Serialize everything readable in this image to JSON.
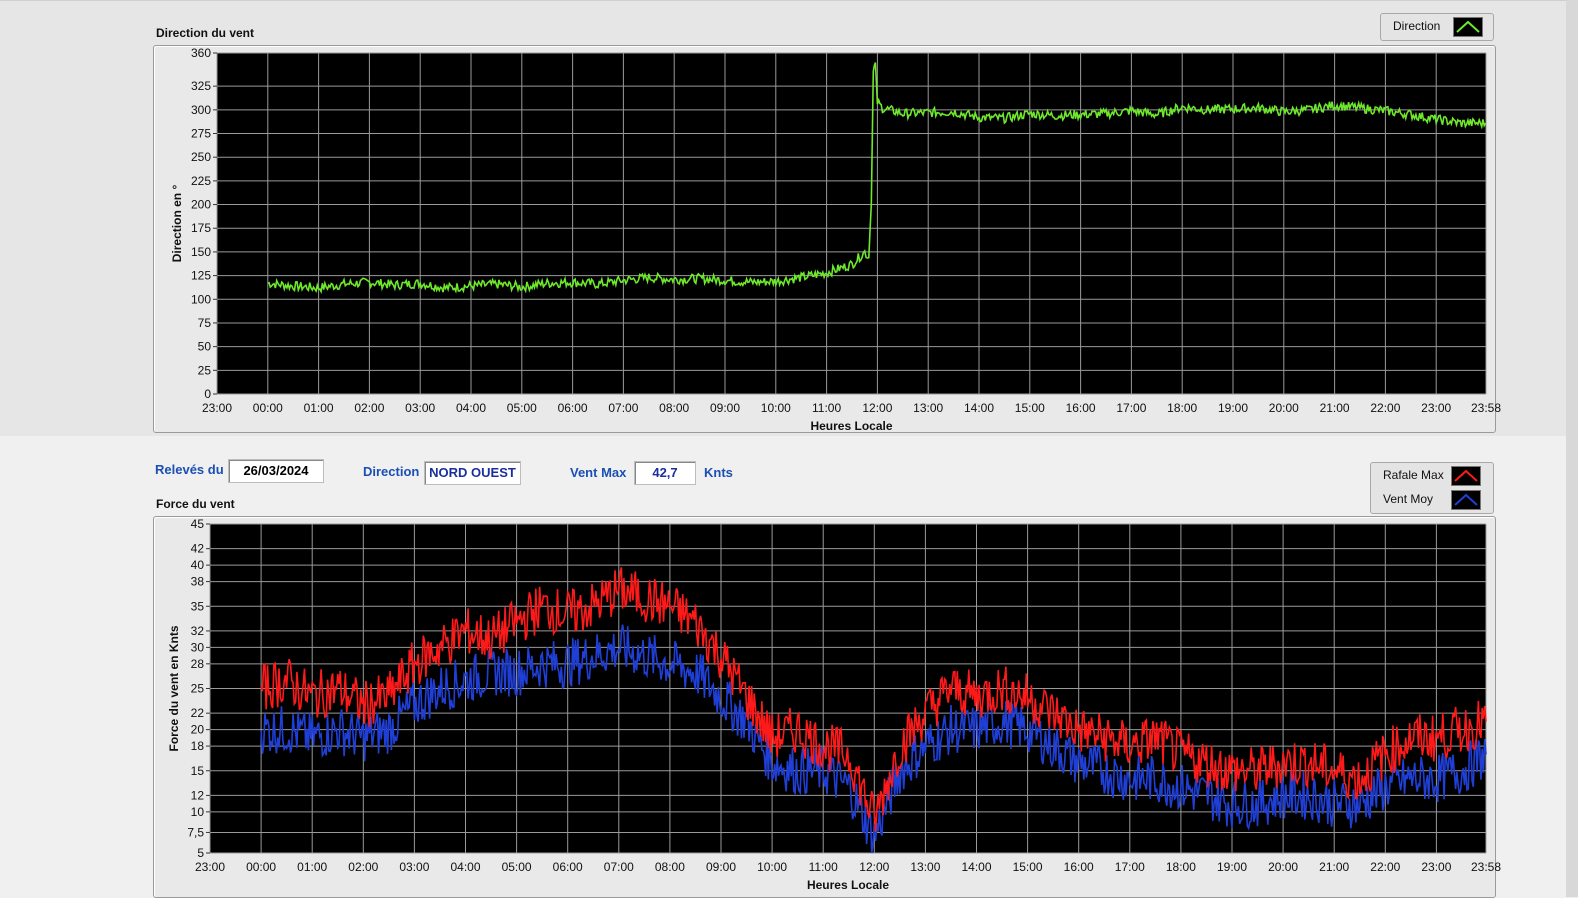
{
  "direction_panel": {
    "title": "Direction du vent",
    "legend": [
      {
        "label": "Direction",
        "color": "#6de82b"
      }
    ]
  },
  "info": {
    "date_label": "Relevés du",
    "date_value": "26/03/2024",
    "direction_label": "Direction",
    "direction_value": "NORD OUEST",
    "ventmax_label": "Vent Max",
    "ventmax_value": "42,7",
    "ventmax_unit": "Knts"
  },
  "force_panel": {
    "title": "Force du vent",
    "legend": [
      {
        "label": "Rafale Max",
        "color": "#ff1a1a"
      },
      {
        "label": "Vent Moy",
        "color": "#1f3fd6"
      }
    ]
  },
  "chart_data": [
    {
      "type": "line",
      "xlabel": "Heures Locale",
      "ylabel": "Direction en °",
      "ylim": [
        0,
        360
      ],
      "y_ticks": [
        "0",
        "25",
        "50",
        "75",
        "100",
        "125",
        "150",
        "175",
        "200",
        "225",
        "250",
        "275",
        "300",
        "325",
        "360"
      ],
      "x_ticks": [
        "23:00",
        "00:00",
        "01:00",
        "02:00",
        "03:00",
        "04:00",
        "05:00",
        "06:00",
        "07:00",
        "08:00",
        "09:00",
        "10:00",
        "11:00",
        "12:00",
        "13:00",
        "14:00",
        "15:00",
        "16:00",
        "17:00",
        "18:00",
        "19:00",
        "20:00",
        "21:00",
        "22:00",
        "23:00",
        "23:58"
      ],
      "grid": true,
      "series": [
        {
          "name": "Direction",
          "x": [
            0.0,
            0.5,
            1.0,
            1.5,
            2.0,
            2.5,
            3.0,
            3.5,
            4.0,
            4.5,
            5.0,
            5.5,
            6.0,
            6.5,
            7.0,
            7.5,
            8.0,
            8.5,
            9.0,
            9.5,
            10.0,
            10.5,
            11.0,
            11.5,
            11.75,
            11.83,
            11.88,
            11.92,
            11.96,
            12.0,
            12.1,
            12.5,
            13.0,
            13.5,
            14.0,
            14.5,
            15.0,
            15.5,
            16.0,
            16.5,
            17.0,
            17.5,
            18.0,
            18.5,
            19.0,
            19.5,
            20.0,
            20.5,
            21.0,
            21.5,
            22.0,
            22.5,
            23.0,
            23.5,
            23.97
          ],
          "y": [
            117,
            114,
            112,
            116,
            118,
            115,
            117,
            112,
            114,
            116,
            113,
            117,
            118,
            116,
            120,
            123,
            121,
            122,
            120,
            118,
            119,
            123,
            128,
            137,
            150,
            144,
            200,
            340,
            350,
            308,
            302,
            296,
            297,
            298,
            292,
            291,
            296,
            294,
            295,
            296,
            299,
            295,
            303,
            300,
            301,
            302,
            298,
            300,
            305,
            302,
            299,
            295,
            290,
            286,
            286
          ]
        }
      ]
    },
    {
      "type": "line",
      "xlabel": "Heures Locale",
      "ylabel": "Force du vent en Knts",
      "ylim": [
        5,
        45
      ],
      "y_ticks": [
        "5",
        "7,5",
        "10",
        "12",
        "15",
        "18",
        "20",
        "22",
        "25",
        "28",
        "30",
        "32",
        "35",
        "38",
        "40",
        "42",
        "45"
      ],
      "x_ticks": [
        "23:00",
        "00:00",
        "01:00",
        "02:00",
        "03:00",
        "04:00",
        "05:00",
        "06:00",
        "07:00",
        "08:00",
        "09:00",
        "10:00",
        "11:00",
        "12:00",
        "13:00",
        "14:00",
        "15:00",
        "16:00",
        "17:00",
        "18:00",
        "19:00",
        "20:00",
        "21:00",
        "22:00",
        "23:00",
        "23:58"
      ],
      "grid": true,
      "series": [
        {
          "name": "Rafale Max",
          "x": [
            0.0,
            0.5,
            1.0,
            1.5,
            2.0,
            2.5,
            3.0,
            3.5,
            4.0,
            4.5,
            5.0,
            5.5,
            6.0,
            6.5,
            7.0,
            7.5,
            8.0,
            8.5,
            9.0,
            9.5,
            10.0,
            10.5,
            11.0,
            11.5,
            12.0,
            12.5,
            13.0,
            13.5,
            14.0,
            14.5,
            15.0,
            15.5,
            16.0,
            16.5,
            17.0,
            17.5,
            18.0,
            18.5,
            19.0,
            19.5,
            20.0,
            20.5,
            21.0,
            21.5,
            22.0,
            22.5,
            23.0,
            23.5,
            23.97
          ],
          "y": [
            25,
            26,
            24,
            25,
            23,
            24,
            28,
            30,
            32,
            31,
            33,
            35,
            34,
            35,
            37,
            36,
            35,
            33,
            29,
            24,
            19,
            20,
            18,
            17,
            9,
            18,
            22,
            25,
            24,
            25,
            24,
            22,
            20,
            19,
            18,
            19,
            17,
            16,
            15,
            15,
            16,
            16,
            15,
            14,
            17,
            19,
            19,
            20,
            21
          ]
        },
        {
          "name": "Vent Moy",
          "x": [
            0.0,
            0.5,
            1.0,
            1.5,
            2.0,
            2.5,
            3.0,
            3.5,
            4.0,
            4.5,
            5.0,
            5.5,
            6.0,
            6.5,
            7.0,
            7.5,
            8.0,
            8.5,
            9.0,
            9.5,
            10.0,
            10.5,
            11.0,
            11.5,
            12.0,
            12.5,
            13.0,
            13.5,
            14.0,
            14.5,
            15.0,
            15.5,
            16.0,
            16.5,
            17.0,
            17.5,
            18.0,
            18.5,
            19.0,
            19.5,
            20.0,
            20.5,
            21.0,
            21.5,
            22.0,
            22.5,
            23.0,
            23.5,
            23.97
          ],
          "y": [
            20,
            20,
            19,
            20,
            19,
            20,
            23,
            25,
            26,
            27,
            27,
            28,
            28,
            29,
            30,
            29,
            28,
            27,
            24,
            21,
            16,
            15,
            15,
            13,
            7,
            15,
            18,
            20,
            20,
            21,
            20,
            18,
            16,
            15,
            14,
            14,
            13,
            12,
            11,
            11,
            12,
            12,
            11,
            11,
            13,
            14,
            14,
            15,
            17
          ]
        }
      ]
    }
  ]
}
